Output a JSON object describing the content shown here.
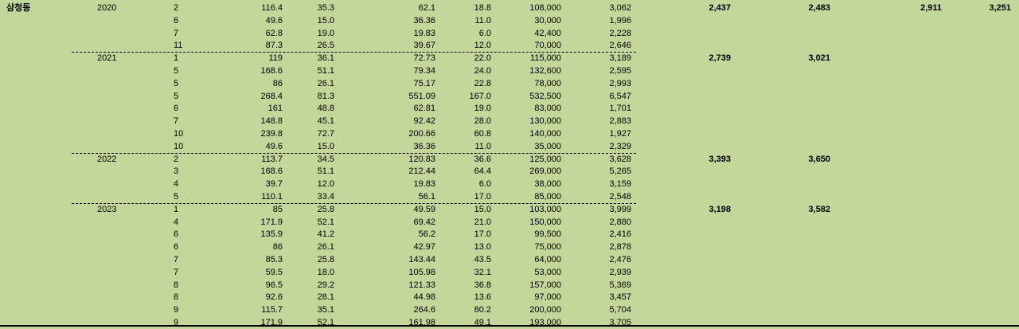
{
  "sheet": {
    "region": "삼청동",
    "colors": {
      "background": "#c4d79b",
      "text": "#000000"
    },
    "groups": [
      {
        "year": "2020",
        "summary": [
          "2,437",
          "2,483",
          "2,911",
          "3,251"
        ],
        "rows": [
          [
            "2",
            "116.4",
            "35.3",
            "62.1",
            "18.8",
            "108,000",
            "3,062"
          ],
          [
            "6",
            "49.6",
            "15.0",
            "36.36",
            "11.0",
            "30,000",
            "1,996"
          ],
          [
            "7",
            "62.8",
            "19.0",
            "19.83",
            "6.0",
            "42,400",
            "2,228"
          ],
          [
            "11",
            "87.3",
            "26.5",
            "39.67",
            "12.0",
            "70,000",
            "2,646"
          ]
        ]
      },
      {
        "year": "2021",
        "summary": [
          "2,739",
          "3,021"
        ],
        "rows": [
          [
            "1",
            "119",
            "36.1",
            "72.73",
            "22.0",
            "115,000",
            "3,189"
          ],
          [
            "5",
            "168.6",
            "51.1",
            "79.34",
            "24.0",
            "132,600",
            "2,595"
          ],
          [
            "5",
            "86",
            "26.1",
            "75.17",
            "22.8",
            "78,000",
            "2,993"
          ],
          [
            "5",
            "268.4",
            "81.3",
            "551.09",
            "167.0",
            "532,500",
            "6,547"
          ],
          [
            "6",
            "161",
            "48.8",
            "62.81",
            "19.0",
            "83,000",
            "1,701"
          ],
          [
            "7",
            "148.8",
            "45.1",
            "92.42",
            "28.0",
            "130,000",
            "2,883"
          ],
          [
            "10",
            "239.8",
            "72.7",
            "200.66",
            "60.8",
            "140,000",
            "1,927"
          ],
          [
            "10",
            "49.6",
            "15.0",
            "36.36",
            "11.0",
            "35,000",
            "2,329"
          ]
        ]
      },
      {
        "year": "2022",
        "summary": [
          "3,393",
          "3,650"
        ],
        "rows": [
          [
            "2",
            "113.7",
            "34.5",
            "120.83",
            "36.6",
            "125,000",
            "3,628"
          ],
          [
            "3",
            "168.6",
            "51.1",
            "212.44",
            "64.4",
            "269,000",
            "5,265"
          ],
          [
            "4",
            "39.7",
            "12.0",
            "19.83",
            "6.0",
            "38,000",
            "3,159"
          ],
          [
            "5",
            "110.1",
            "33.4",
            "56.1",
            "17.0",
            "85,000",
            "2,548"
          ]
        ]
      },
      {
        "year": "2023",
        "summary": [
          "3,198",
          "3,582"
        ],
        "rows": [
          [
            "1",
            "85",
            "25.8",
            "49.59",
            "15.0",
            "103,000",
            "3,999"
          ],
          [
            "4",
            "171.9",
            "52.1",
            "69.42",
            "21.0",
            "150,000",
            "2,880"
          ],
          [
            "6",
            "135.9",
            "41.2",
            "56.2",
            "17.0",
            "99,500",
            "2,416"
          ],
          [
            "6",
            "86",
            "26.1",
            "42.97",
            "13.0",
            "75,000",
            "2,878"
          ],
          [
            "7",
            "85.3",
            "25.8",
            "143.44",
            "43.5",
            "64,000",
            "2,476"
          ],
          [
            "7",
            "59.5",
            "18.0",
            "105.98",
            "32.1",
            "53,000",
            "2,939"
          ],
          [
            "8",
            "96.5",
            "29.2",
            "121.33",
            "36.8",
            "157,000",
            "5,369"
          ],
          [
            "8",
            "92.6",
            "28.1",
            "44.98",
            "13.6",
            "97,000",
            "3,457"
          ],
          [
            "9",
            "115.7",
            "35.1",
            "264.6",
            "80.2",
            "200,000",
            "5,704"
          ],
          [
            "9",
            "171.9",
            "52.1",
            "161.98",
            "49.1",
            "193,000",
            "3,705"
          ]
        ]
      }
    ]
  }
}
